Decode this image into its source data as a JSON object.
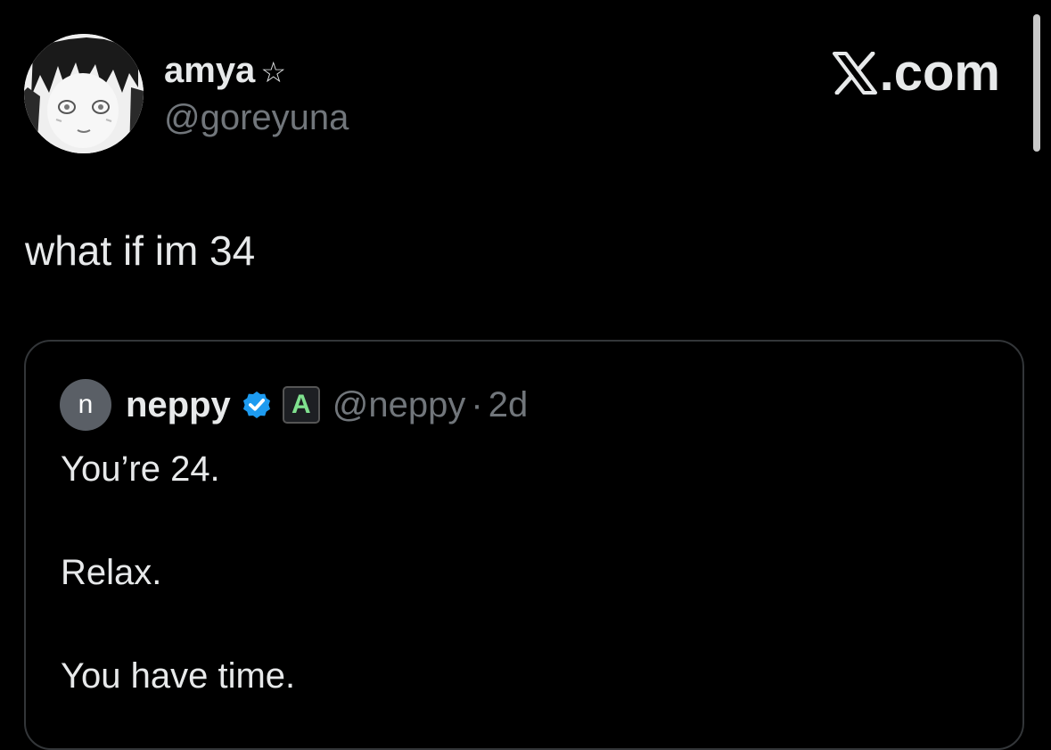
{
  "author": {
    "display_name": "amya",
    "badge": "☆",
    "handle": "@goreyuna",
    "avatar_icon": "anime-avatar-icon"
  },
  "brand": {
    "logo_icon": "x-logo-icon",
    "text": ".com"
  },
  "tweet": {
    "text": "what if im 34"
  },
  "quoted_tweet": {
    "avatar_letter": "n",
    "display_name": "neppy",
    "verified_icon": "verified-badge-icon",
    "affiliate_letter": "A",
    "handle": "@neppy",
    "separator": "·",
    "time": "2d",
    "lines": [
      "You’re 24.",
      "Relax.",
      "You have time."
    ]
  },
  "colors": {
    "background": "#000000",
    "primary_text": "#e7e9ea",
    "secondary_text": "#71767b",
    "card_border": "#333639",
    "verified": "#1d9bf0",
    "affiliate_text": "#7fe08e"
  }
}
